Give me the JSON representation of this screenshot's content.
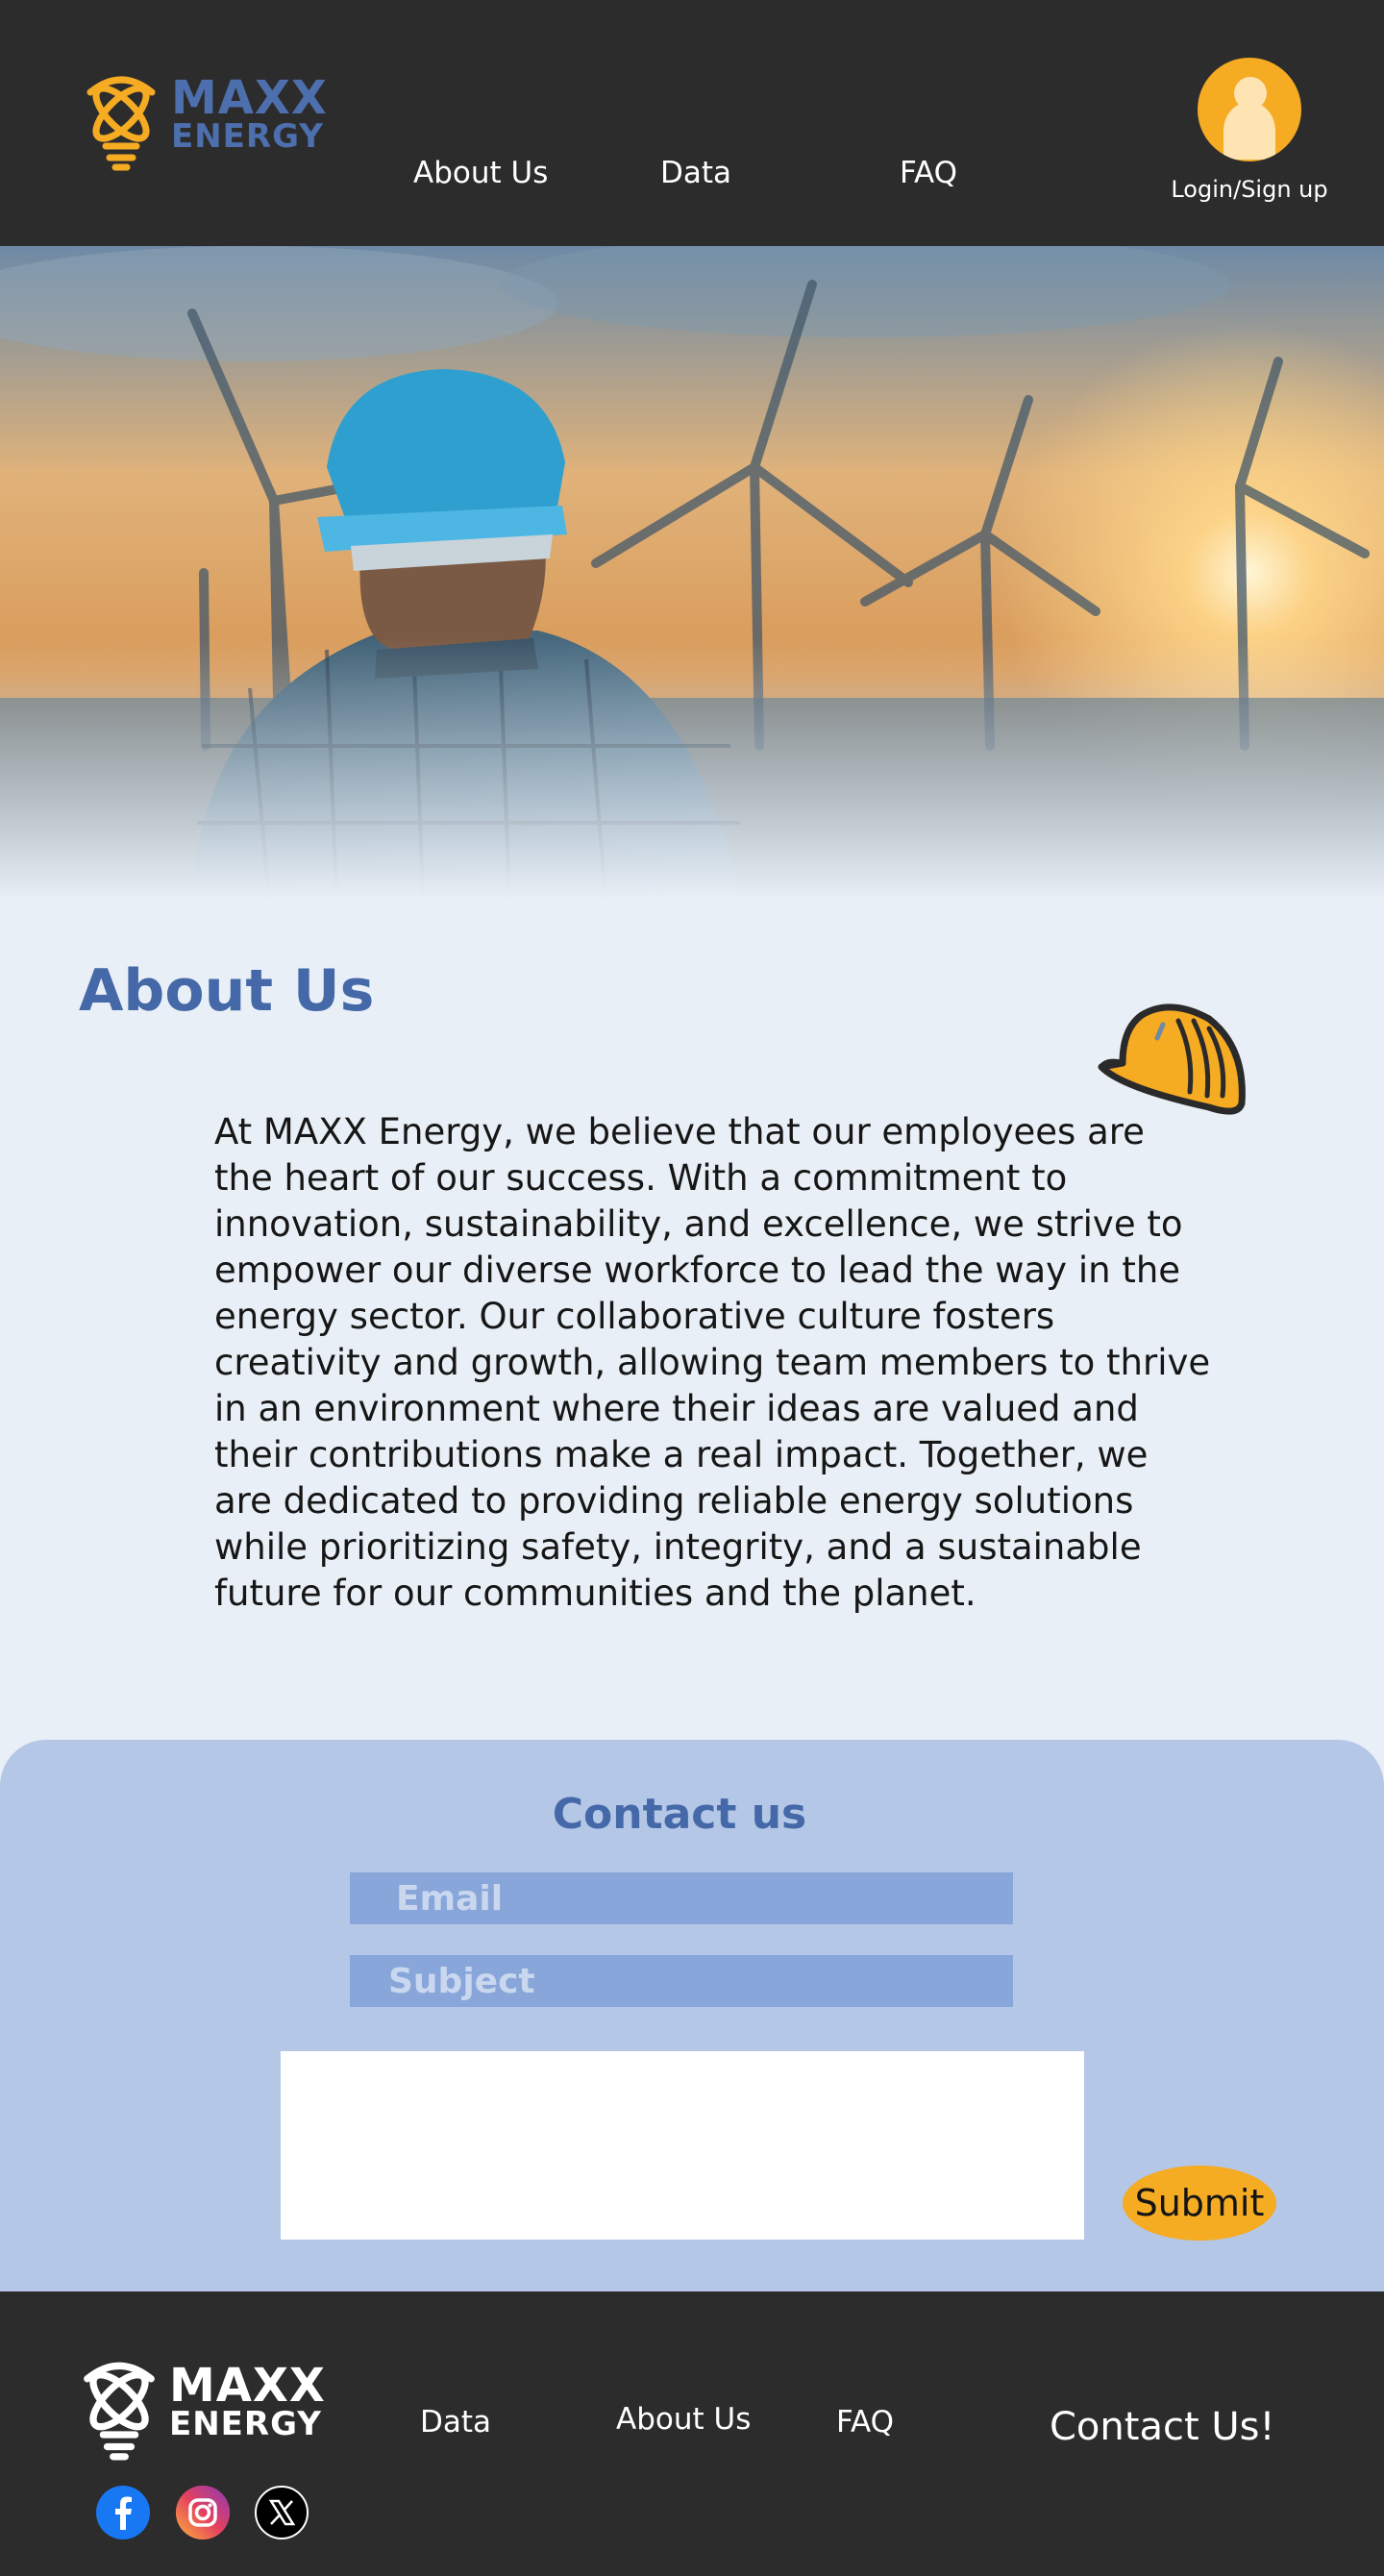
{
  "header": {
    "logo": {
      "line1": "MAXX",
      "line2": "ENERGY"
    },
    "nav": [
      {
        "label": "About Us"
      },
      {
        "label": "Data"
      },
      {
        "label": "FAQ"
      }
    ],
    "login_label": "Login/Sign up"
  },
  "about": {
    "title": "About Us",
    "text": "At MAXX Energy, we believe that our employees are the heart of our success. With a commitment to innovation, sustainability, and excellence, we strive to empower our diverse workforce to lead the way in the energy sector. Our collaborative culture fosters creativity and growth, allowing team members to thrive in an environment where their ideas are valued and their contributions make a real impact. Together, we are dedicated to providing reliable energy solutions while prioritizing safety, integrity, and a sustainable future for our communities and the planet."
  },
  "contact": {
    "title": "Contact us",
    "email_placeholder": "Email",
    "subject_placeholder": "Subject",
    "submit_label": "Submit"
  },
  "footer": {
    "logo": {
      "line1": "MAXX",
      "line2": "ENERGY"
    },
    "links": [
      {
        "label": "Data"
      },
      {
        "label": "About Us"
      },
      {
        "label": "FAQ"
      }
    ],
    "contact_label": "Contact Us!",
    "social": [
      "facebook-icon",
      "instagram-icon",
      "x-icon"
    ]
  },
  "colors": {
    "header_bg": "#2c2c2d",
    "brand_blue": "#4468a8",
    "accent_orange": "#f5ab22",
    "page_bg": "#e9eff6",
    "contact_bg": "#b5c7e6",
    "field_bg": "#88a6d9"
  }
}
